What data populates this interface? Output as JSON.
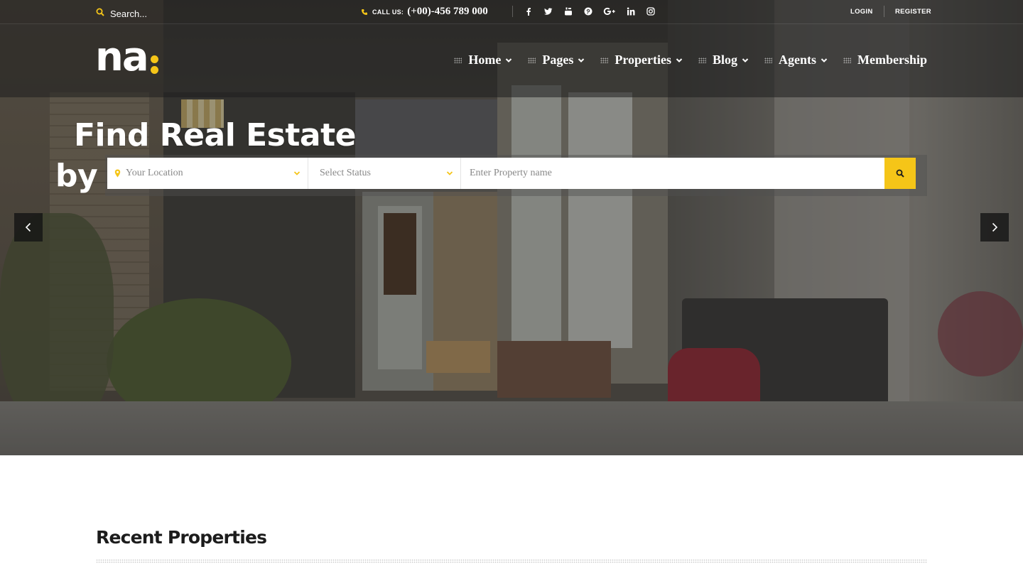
{
  "colors": {
    "accent": "#f5c518",
    "dark": "#1c1c1c"
  },
  "topbar": {
    "search_placeholder": "Search...",
    "call_label": "CALL US:",
    "phone": "(+00)-456 789 000",
    "social": [
      "facebook-icon",
      "twitter-icon",
      "youtube-icon",
      "pinterest-icon",
      "google-plus-icon",
      "linkedin-icon",
      "instagram-icon"
    ],
    "login": "LOGIN",
    "register": "REGISTER"
  },
  "logo": {
    "text": "na"
  },
  "nav": {
    "items": [
      {
        "label": "Home",
        "dropdown": true
      },
      {
        "label": "Pages",
        "dropdown": true
      },
      {
        "label": "Properties",
        "dropdown": true
      },
      {
        "label": "Blog",
        "dropdown": true
      },
      {
        "label": "Agents",
        "dropdown": true
      },
      {
        "label": "Membership",
        "dropdown": false
      }
    ]
  },
  "hero": {
    "headline_line1": "Find Real Estate",
    "headline_line2": "by",
    "search": {
      "location_placeholder": "Your Location",
      "status_placeholder": "Select Status",
      "property_placeholder": "Enter Property name"
    }
  },
  "section": {
    "title": "Recent Properties"
  }
}
